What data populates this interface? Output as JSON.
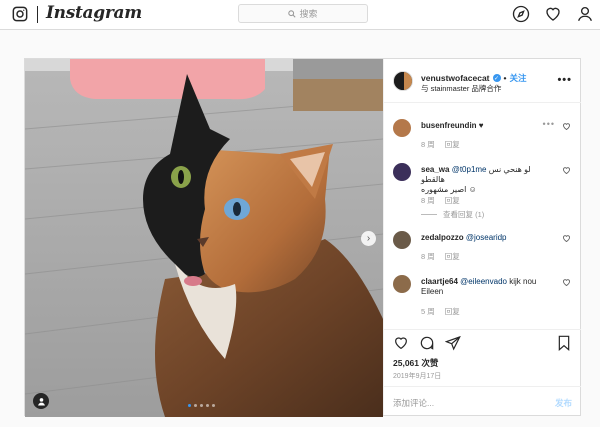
{
  "app": {
    "name": "Instagram"
  },
  "search": {
    "placeholder": "搜索"
  },
  "nav": {
    "icons": [
      "compass-icon",
      "heart-icon",
      "profile-icon"
    ]
  },
  "post": {
    "carousel": {
      "count": 5,
      "active": 0
    },
    "author": {
      "username": "venustwofacecat",
      "follow_label": "关注",
      "subtitle": "与 stainmaster 品牌合作",
      "more": "•••"
    },
    "comments": [
      {
        "username": "busenfreundin",
        "text": "♥",
        "time": "8 周",
        "reply": "回复",
        "show_more": true
      },
      {
        "username": "sea_wa",
        "mention": "@t0p1me",
        "text": "لو هنحي نس هالقطو",
        "text2": "اصير مشهوره ☺",
        "time": "8 周",
        "reply": "回复",
        "view_replies": "查看回复 (1)"
      },
      {
        "username": "zedalpozzo",
        "mention": "@josearidp",
        "text": "",
        "time": "8 周",
        "reply": "回复"
      },
      {
        "username": "claartje64",
        "mention": "@eileenvado",
        "text": "kijk nou Eileen",
        "time": "5 周",
        "reply": "回复"
      }
    ],
    "likes": "25,061 次赞",
    "date": "2019年9月17日",
    "add_comment_placeholder": "添加评论...",
    "post_button": "发布"
  },
  "colors": {
    "accent": "#3897f0",
    "border": "#dbdbdb",
    "muted": "#999999"
  }
}
